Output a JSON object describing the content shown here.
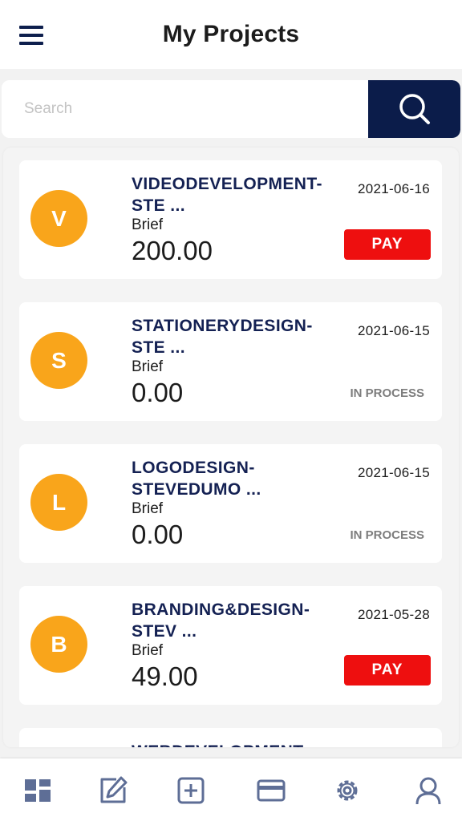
{
  "header": {
    "title": "My Projects"
  },
  "search": {
    "placeholder": "Search"
  },
  "projects": [
    {
      "initial": "V",
      "title": "VIDEODEVELOPMENT-STE ...",
      "subtitle": "Brief",
      "amount": "200.00",
      "date": "2021-06-16",
      "action": "PAY"
    },
    {
      "initial": "S",
      "title": "STATIONERYDESIGN-STE ...",
      "subtitle": "Brief",
      "amount": "0.00",
      "date": "2021-06-15",
      "status": "IN PROCESS"
    },
    {
      "initial": "L",
      "title": "LOGODESIGN-STEVEDUMO ...",
      "subtitle": "Brief",
      "amount": "0.00",
      "date": "2021-06-15",
      "status": "IN PROCESS"
    },
    {
      "initial": "B",
      "title": "BRANDING&DESIGN-STEV ...",
      "subtitle": "Brief",
      "amount": "49.00",
      "date": "2021-05-28",
      "action": "PAY"
    },
    {
      "title": "WEBDEVELOPMENT-"
    }
  ],
  "tabs": [
    {
      "icon": "dashboard-icon"
    },
    {
      "icon": "edit-icon"
    },
    {
      "icon": "add-square-icon"
    },
    {
      "icon": "credit-card-icon"
    },
    {
      "icon": "settings-icon"
    },
    {
      "icon": "user-icon"
    }
  ],
  "colors": {
    "navy": "#0b1c4a",
    "accent_orange": "#f9a51b",
    "pay_red": "#ee0f0f",
    "status_gray": "#7d7d7d",
    "tab_icon": "#5e6e96"
  }
}
